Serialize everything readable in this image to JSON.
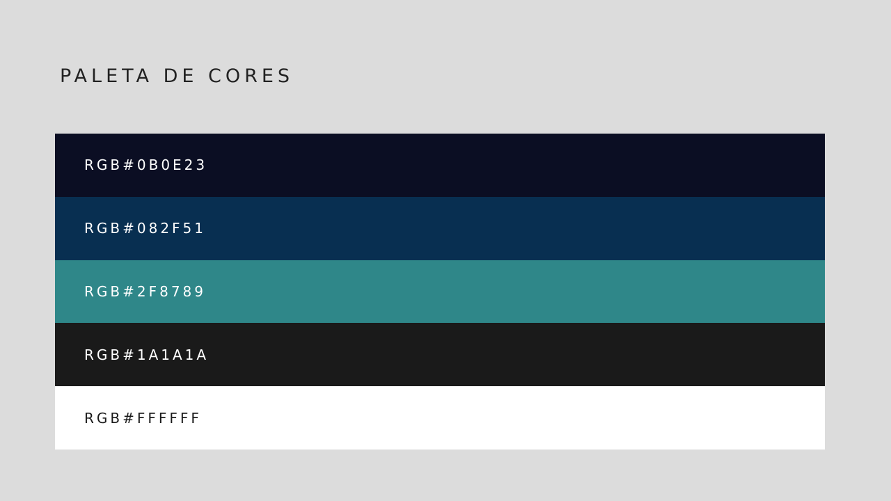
{
  "title": "PALETA DE CORES",
  "swatches": [
    {
      "label": "RGB#0B0E23",
      "color": "#0b0e23",
      "text_color": "#ffffff"
    },
    {
      "label": "RGB#082F51",
      "color": "#082f51",
      "text_color": "#ffffff"
    },
    {
      "label": "RGB#2F8789",
      "color": "#2f8789",
      "text_color": "#ffffff"
    },
    {
      "label": "RGB#1A1A1A",
      "color": "#1a1a1a",
      "text_color": "#ffffff"
    },
    {
      "label": "RGB#FFFFFF",
      "color": "#ffffff",
      "text_color": "#1a1a1a"
    }
  ]
}
